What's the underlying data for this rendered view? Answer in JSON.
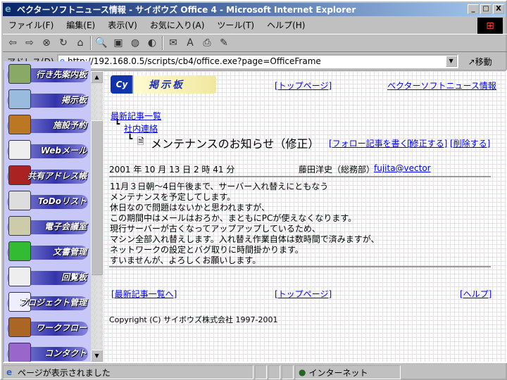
{
  "window": {
    "title": "ベクターソフトニュース情報 - サイボウズ Office 4 - Microsoft Internet Explorer",
    "minimize": "_",
    "maximize": "□",
    "close": "X"
  },
  "menu": [
    "ファイル(F)",
    "編集(E)",
    "表示(V)",
    "お気に入り(A)",
    "ツール(T)",
    "ヘルプ(H)"
  ],
  "toolbar_icons": [
    "back-icon",
    "forward-icon",
    "stop-icon",
    "refresh-icon",
    "home-icon",
    "search-icon",
    "favorites-icon",
    "history-icon",
    "channels-icon",
    "mail-icon",
    "edit-icon",
    "print-icon",
    "discuss-icon"
  ],
  "address": {
    "label": "アドレス(D)",
    "url": "http://192.168.0.5/scripts/cb4/office.exe?page=OfficeFrame",
    "go": "移動"
  },
  "sidebar": {
    "items": [
      {
        "label": "行き先案内板",
        "color": "#8a6"
      },
      {
        "label": "掲示板",
        "color": "#9bd"
      },
      {
        "label": "施設予約",
        "color": "#b72"
      },
      {
        "label": "Webメール",
        "color": "#eee"
      },
      {
        "label": "共有アドレス帳",
        "color": "#a22"
      },
      {
        "label": "ToDoリスト",
        "color": "#ddd"
      },
      {
        "label": "電子会議室",
        "color": "#cca"
      },
      {
        "label": "文書管理",
        "color": "#3b3"
      },
      {
        "label": "回覧板",
        "color": "#eee"
      },
      {
        "label": "プロジェクト管理",
        "color": "#eef"
      },
      {
        "label": "ワークフロー",
        "color": "#a62"
      },
      {
        "label": "コンタクト",
        "color": "#96c"
      }
    ]
  },
  "main": {
    "logo_text": "掲示板",
    "top_link": "[トップページ]",
    "site_link": "ベクターソフトニュース情報",
    "breadcrumb": {
      "root": "最新記事一覧",
      "category": "社内連絡"
    },
    "article_title": "メンテナンスのお知らせ（修正）",
    "actions": {
      "follow": "[フォロー記事を書く]",
      "edit": "[修正する]",
      "delete": "[削除する]"
    },
    "date": "2001 年 10 月 13 日 2 時 41 分",
    "author": "藤田洋史（総務部）",
    "email": "fujita@vector",
    "body": "11月３日朝～4日午後まで、サーバー入れ替えにともなう\nメンテナンスを予定してします。\n休日なので問題はないかと思われますが、\nこの期間中はメールはおろか、まともにPCが使えなくなります。\n現行サーバーが古くなってアップアップしているため、\nマシン全部入れ替えします。入れ替え作業自体は数時間で済みますが、\nネットワークの設定とバグ取りに時間掛かります。\nすいませんが、よろしくお願いします。",
    "footer_links": {
      "latest": "[最新記事一覧へ]",
      "top": "[トップページ]",
      "help": "[ヘルプ]"
    },
    "copyright": "Copyright (C) サイボウズ株式会社 1997-2001"
  },
  "status": {
    "text": "ページが表示されました",
    "zone": "インターネット"
  }
}
